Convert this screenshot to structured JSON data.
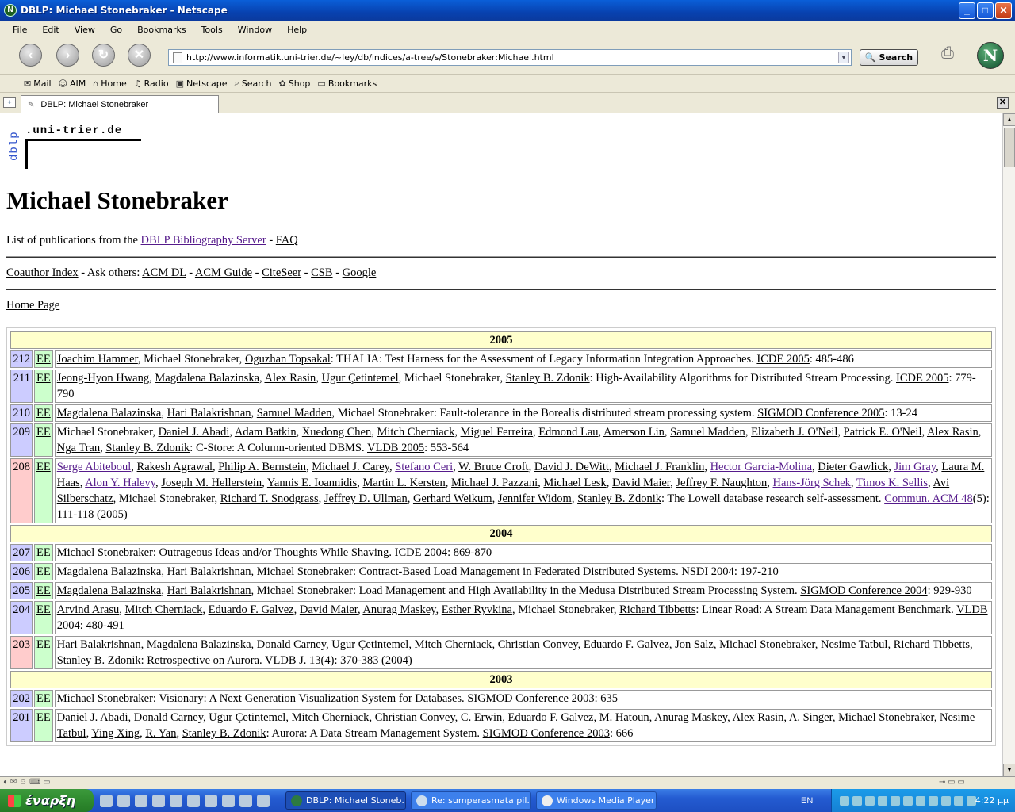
{
  "window": {
    "title": "DBLP: Michael Stonebraker - Netscape"
  },
  "menu": [
    "File",
    "Edit",
    "View",
    "Go",
    "Bookmarks",
    "Tools",
    "Window",
    "Help"
  ],
  "nav": {
    "url": "http://www.informatik.uni-trier.de/~ley/db/indices/a-tree/s/Stonebraker:Michael.html",
    "search_label": "Search"
  },
  "personal_toolbar": [
    "Mail",
    "AIM",
    "Home",
    "Radio",
    "Netscape",
    "Search",
    "Shop",
    "Bookmarks"
  ],
  "tab": {
    "label": "DBLP: Michael Stonebraker"
  },
  "page": {
    "logo_vertical": "dblp",
    "logo_horizontal": ".uni-trier.de",
    "heading": "Michael Stonebraker",
    "intro_text": "List of publications from the ",
    "intro_link": "DBLP Bibliography Server",
    "intro_sep": " - ",
    "faq": "FAQ",
    "coauthor": "Coauthor Index",
    "ask_others": " - Ask others: ",
    "links": [
      "ACM DL",
      "ACM Guide",
      "CiteSeer",
      "CSB",
      "Google"
    ],
    "home": "Home Page"
  },
  "publications": [
    {
      "year": "2005"
    },
    {
      "num": "212",
      "ee": "EE",
      "html": "<u>Joachim Hammer</u>, Michael Stonebraker, <u>Oguzhan Topsakal</u>: THALIA: Test Harness for the Assessment of Legacy Information Integration Approaches. <u>ICDE 2005</u>: 485-486"
    },
    {
      "num": "211",
      "ee": "EE",
      "html": "<u>Jeong-Hyon Hwang</u>, <u>Magdalena Balazinska</u>, <u>Alex Rasin</u>, <u>Ugur Çetintemel</u>, Michael Stonebraker, <u>Stanley B. Zdonik</u>: High-Availability Algorithms for Distributed Stream Processing. <u>ICDE 2005</u>: 779-790"
    },
    {
      "num": "210",
      "ee": "EE",
      "html": "<u>Magdalena Balazinska</u>, <u>Hari Balakrishnan</u>, <u>Samuel Madden</u>, Michael Stonebraker: Fault-tolerance in the Borealis distributed stream processing system. <u>SIGMOD Conference 2005</u>: 13-24"
    },
    {
      "num": "209",
      "ee": "EE",
      "html": "Michael Stonebraker, <u>Daniel J. Abadi</u>, <u>Adam Batkin</u>, <u>Xuedong Chen</u>, <u>Mitch Cherniack</u>, <u>Miguel Ferreira</u>, <u>Edmond Lau</u>, <u>Amerson Lin</u>, <u>Samuel Madden</u>, <u>Elizabeth J. O'Neil</u>, <u>Patrick E. O'Neil</u>, <u>Alex Rasin</u>, <u>Nga Tran</u>, <u>Stanley B. Zdonik</u>: C-Store: A Column-oriented DBMS. <u>VLDB 2005</u>: 553-564"
    },
    {
      "num": "208",
      "red": true,
      "ee": "EE",
      "html": "<span class='vis'>Serge Abiteboul</span>, <u>Rakesh Agrawal</u>, <u>Philip A. Bernstein</u>, <u>Michael J. Carey</u>, <span class='vis'>Stefano Ceri</span>, <u>W. Bruce Croft</u>, <u>David J. DeWitt</u>, <u>Michael J. Franklin</u>, <span class='vis'>Hector Garcia-Molina</span>, <u>Dieter Gawlick</u>, <span class='vis'>Jim Gray</span>, <u>Laura M. Haas</u>, <span class='vis'>Alon Y. Halevy</span>, <u>Joseph M. Hellerstein</u>, <u>Yannis E. Ioannidis</u>, <u>Martin L. Kersten</u>, <u>Michael J. Pazzani</u>, <u>Michael Lesk</u>, <u>David Maier</u>, <u>Jeffrey F. Naughton</u>, <span class='vis'>Hans-Jörg Schek</span>, <span class='vis'>Timos K. Sellis</span>, <u>Avi Silberschatz</u>, Michael Stonebraker, <u>Richard T. Snodgrass</u>, <u>Jeffrey D. Ullman</u>, <u>Gerhard Weikum</u>, <u>Jennifer Widom</u>, <u>Stanley B. Zdonik</u>: The Lowell database research self-assessment. <span class='vis'>Commun. ACM 48</span>(5): 111-118 (2005)"
    },
    {
      "year": "2004"
    },
    {
      "num": "207",
      "ee": "EE",
      "html": "Michael Stonebraker: Outrageous Ideas and/or Thoughts While Shaving. <u>ICDE 2004</u>: 869-870"
    },
    {
      "num": "206",
      "ee": "EE",
      "html": "<u>Magdalena Balazinska</u>, <u>Hari Balakrishnan</u>, Michael Stonebraker: Contract-Based Load Management in Federated Distributed Systems. <u>NSDI 2004</u>: 197-210"
    },
    {
      "num": "205",
      "ee": "EE",
      "html": "<u>Magdalena Balazinska</u>, <u>Hari Balakrishnan</u>, Michael Stonebraker: Load Management and High Availability in the Medusa Distributed Stream Processing System. <u>SIGMOD Conference 2004</u>: 929-930"
    },
    {
      "num": "204",
      "ee": "EE",
      "html": "<u>Arvind Arasu</u>, <u>Mitch Cherniack</u>, <u>Eduardo F. Galvez</u>, <u>David Maier</u>, <u>Anurag Maskey</u>, <u>Esther Ryvkina</u>, Michael Stonebraker, <u>Richard Tibbetts</u>: Linear Road: A Stream Data Management Benchmark. <u>VLDB 2004</u>: 480-491"
    },
    {
      "num": "203",
      "red": true,
      "ee": "EE",
      "html": "<u>Hari Balakrishnan</u>, <u>Magdalena Balazinska</u>, <u>Donald Carney</u>, <u>Ugur Çetintemel</u>, <u>Mitch Cherniack</u>, <u>Christian Convey</u>, <u>Eduardo F. Galvez</u>, <u>Jon Salz</u>, Michael Stonebraker, <u>Nesime Tatbul</u>, <u>Richard Tibbetts</u>, <u>Stanley B. Zdonik</u>: Retrospective on Aurora. <u>VLDB J. 13</u>(4): 370-383 (2004)"
    },
    {
      "year": "2003"
    },
    {
      "num": "202",
      "ee": "EE",
      "html": "Michael Stonebraker: Visionary: A Next Generation Visualization System for Databases. <u>SIGMOD Conference 2003</u>: 635"
    },
    {
      "num": "201",
      "ee": "EE",
      "html": "<u>Daniel J. Abadi</u>, <u>Donald Carney</u>, <u>Ugur Çetintemel</u>, <u>Mitch Cherniack</u>, <u>Christian Convey</u>, <u>C. Erwin</u>, <u>Eduardo F. Galvez</u>, <u>M. Hatoun</u>, <u>Anurag Maskey</u>, <u>Alex Rasin</u>, <u>A. Singer</u>, Michael Stonebraker, <u>Nesime Tatbul</u>, <u>Ying Xing</u>, <u>R. Yan</u>, <u>Stanley B. Zdonik</u>: Aurora: A Data Stream Management System. <u>SIGMOD Conference 2003</u>: 666"
    }
  ],
  "taskbar": {
    "start": "έναρξη",
    "tasks": [
      "DBLP: Michael Stoneb...",
      "Re: sumperasmata pil...",
      "Windows Media Player"
    ],
    "lang": "EN",
    "clock": "4:22 μμ"
  }
}
